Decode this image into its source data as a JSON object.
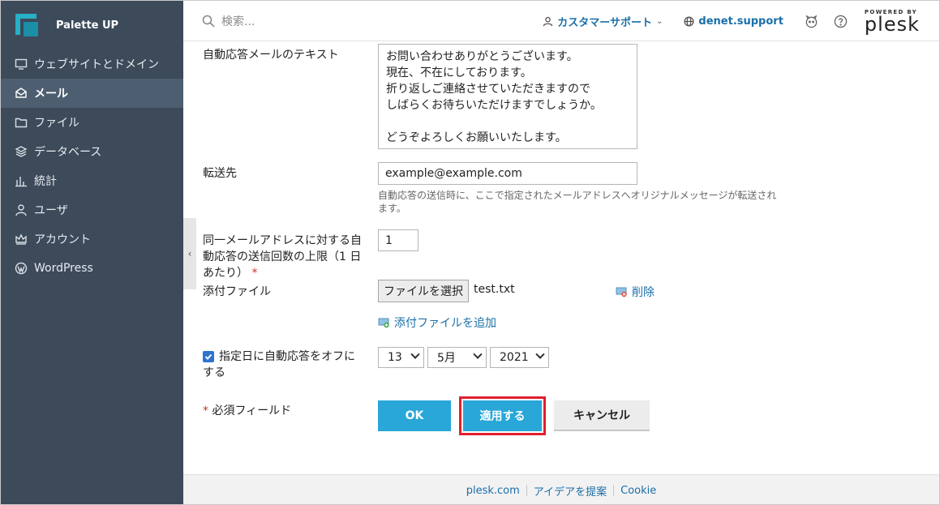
{
  "brand": {
    "name": "Palette UP"
  },
  "sidebar": {
    "items": [
      {
        "label": "ウェブサイトとドメイン",
        "icon": "monitor-icon",
        "active": false
      },
      {
        "label": "メール",
        "icon": "mail-icon",
        "active": true
      },
      {
        "label": "ファイル",
        "icon": "folder-icon",
        "active": false
      },
      {
        "label": "データベース",
        "icon": "database-icon",
        "active": false
      },
      {
        "label": "統計",
        "icon": "bar-chart-icon",
        "active": false
      },
      {
        "label": "ユーザ",
        "icon": "user-icon",
        "active": false
      },
      {
        "label": "アカウント",
        "icon": "crown-icon",
        "active": false
      },
      {
        "label": "WordPress",
        "icon": "wordpress-icon",
        "active": false
      }
    ]
  },
  "header": {
    "search_placeholder": "検索...",
    "support_label": "カスタマーサポート",
    "account_label": "denet.support",
    "powered_by": "POWERED BY",
    "plesk": "plesk"
  },
  "form": {
    "autoreply_text_label": "自動応答メールのテキスト",
    "autoreply_text_value": "お問い合わせありがとうございます。\n現在、不在にしております。\n折り返しご連絡させていただきますので\nしばらくお待ちいただけますでしょうか。\n\nどうぞよろしくお願いいたします。",
    "forward_label": "転送先",
    "forward_value": "example@example.com",
    "forward_hint": "自動応答の送信時に、ここで指定されたメールアドレスへオリジナルメッセージが転送されます。",
    "limit_label_1": "同一メールアドレスに対する自",
    "limit_label_2": "動応答の送信回数の上限（1 日",
    "limit_label_3": "あたり）",
    "limit_value": "1",
    "attach_label": "添付ファイル",
    "choose_file_label": "ファイルを選択",
    "file_name": "test.txt",
    "delete_label": "削除",
    "add_attach_label": "添付ファイルを追加",
    "offdate_label_1": "指定日に自動応答をオフに",
    "offdate_label_2": "する",
    "offdate_checked": true,
    "day": "13",
    "month": "5月",
    "year": "2021",
    "required_note": "必須フィールド",
    "required_mark": "*"
  },
  "buttons": {
    "ok": "OK",
    "apply": "適用する",
    "cancel": "キャンセル"
  },
  "footer": {
    "links": [
      "plesk.com",
      "アイデアを提案",
      "Cookie"
    ]
  },
  "colors": {
    "sidebar": "#3c4a5a",
    "accent": "#28a7d8",
    "highlight": "#e0202f",
    "link": "#1a6fa8"
  }
}
